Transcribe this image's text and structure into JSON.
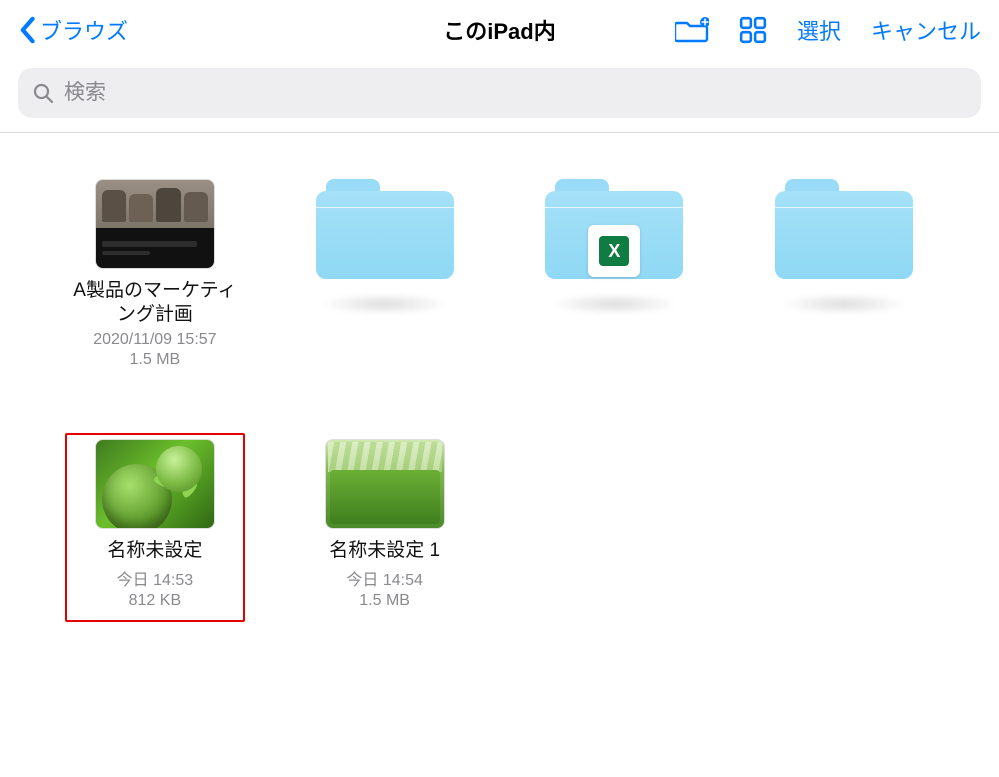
{
  "header": {
    "back_label": "ブラウズ",
    "title": "このiPad内",
    "select_label": "選択",
    "cancel_label": "キャンセル"
  },
  "search": {
    "placeholder": "検索"
  },
  "icons": {
    "back": "chevron-left-icon",
    "new_folder": "new-folder-icon",
    "view_mode": "grid-view-icon",
    "search": "search-icon"
  },
  "colors": {
    "accent": "#007aff",
    "highlight_border": "#e30000",
    "folder": "#8fd8f4"
  },
  "items": [
    {
      "kind": "file",
      "thumb_variant": "presentation",
      "name": "A製品のマーケティング計画",
      "date": "2020/11/09 15:57",
      "size": "1.5 MB",
      "highlighted": false
    },
    {
      "kind": "folder",
      "thumb_variant": "folder",
      "overlay": null,
      "name": "",
      "date": "",
      "size": ""
    },
    {
      "kind": "folder",
      "thumb_variant": "folder",
      "overlay": "excel",
      "name": "",
      "date": "",
      "size": ""
    },
    {
      "kind": "folder",
      "thumb_variant": "folder",
      "overlay": null,
      "name": "",
      "date": "",
      "size": ""
    },
    {
      "kind": "file",
      "thumb_variant": "greens",
      "name": "名称未設定",
      "date": "今日 14:53",
      "size": "812 KB",
      "highlighted": true
    },
    {
      "kind": "file",
      "thumb_variant": "nature",
      "name": "名称未設定 1",
      "date": "今日 14:54",
      "size": "1.5 MB",
      "highlighted": false
    }
  ]
}
